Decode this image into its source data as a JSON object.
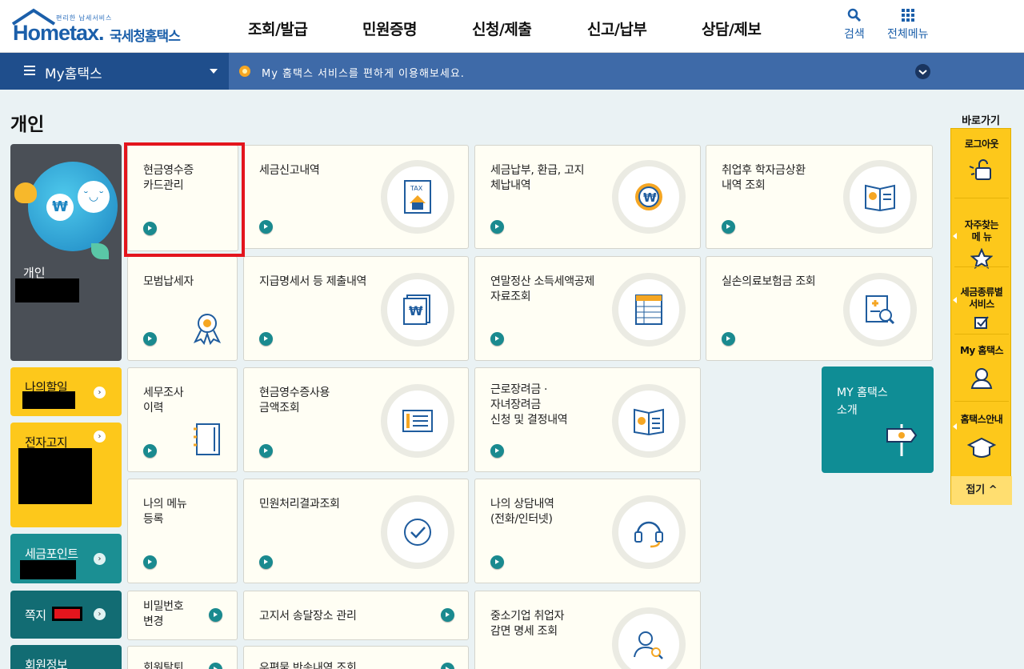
{
  "header": {
    "logo_small": "편리한 납세서비스",
    "logo_main": "Hometax.",
    "logo_kr": "국세청홈택스",
    "nav": [
      "조회/발급",
      "민원증명",
      "신청/제출",
      "신고/납부",
      "상담/제보"
    ],
    "search_label": "검색",
    "menu_label": "전체메뉴"
  },
  "subbar": {
    "my_title": "My홈택스",
    "notice": "My 홈택스 서비스를 편하게 이용해보세요."
  },
  "page_title": "개인",
  "profile": {
    "name": "개인"
  },
  "left_tiles": {
    "todo": "나의할일",
    "enotice": "전자고지",
    "taxpoint": "세금포인트",
    "message": "쪽지",
    "member": "회원정보"
  },
  "cards": {
    "c1": "현금영수증\n카드관리",
    "c2": "세금신고내역",
    "c3": "세금납부, 환급, 고지\n체납내역",
    "c4": "취업후 학자금상환\n내역 조회",
    "c5": "모범납세자",
    "c6": "지급명세서 등 제출내역",
    "c7": "연말정산 소득세액공제\n자료조회",
    "c8": "실손의료보험금 조회",
    "c9": "세무조사\n이력",
    "c10": "현금영수증사용\n금액조회",
    "c11": "근로장려금 ·\n자녀장려금\n신청 및 결정내역",
    "c12": "나의 메뉴\n등록",
    "c13": "민원처리결과조회",
    "c14": "나의 상담내역\n(전화/인터넷)",
    "c15": "비밀번호\n변경",
    "c16": "고지서 송달장소 관리",
    "c17": "중소기업 취업자\n감면 명세 조회",
    "c18": "회원탈퇴",
    "c19": "우편물 반송내역 조회"
  },
  "intro": "MY 홈택스\n소개",
  "quick": {
    "head": "바로가기",
    "logout": "로그아웃",
    "faq": "자주찾는\n메 뉴",
    "taxservice": "세금종류별\n서비스",
    "myhometax": "My 홈택스",
    "guide": "홈택스안내",
    "fold": "접기 ^"
  },
  "icons": [
    "search-icon",
    "grid-menu-icon",
    "hamburger-icon",
    "flower-icon",
    "chevron-down-icon",
    "tax-house-icon",
    "won-coin-icon",
    "book-plus-icon",
    "award-ribbon-icon",
    "won-document-icon",
    "spreadsheet-icon",
    "document-search-icon",
    "notebook-icon",
    "receipt-icon",
    "check-circle-icon",
    "headset-icon",
    "user-search-icon",
    "signpost-icon",
    "lock-icon",
    "star-icon",
    "checkbox-icon",
    "user-icon",
    "hat-icon"
  ],
  "colors": {
    "brand_blue": "#1b5faa",
    "subbar": "#3e6aa8",
    "yellow": "#fdc81b",
    "teal": "#1b8f93",
    "selection": "#e3151d"
  }
}
